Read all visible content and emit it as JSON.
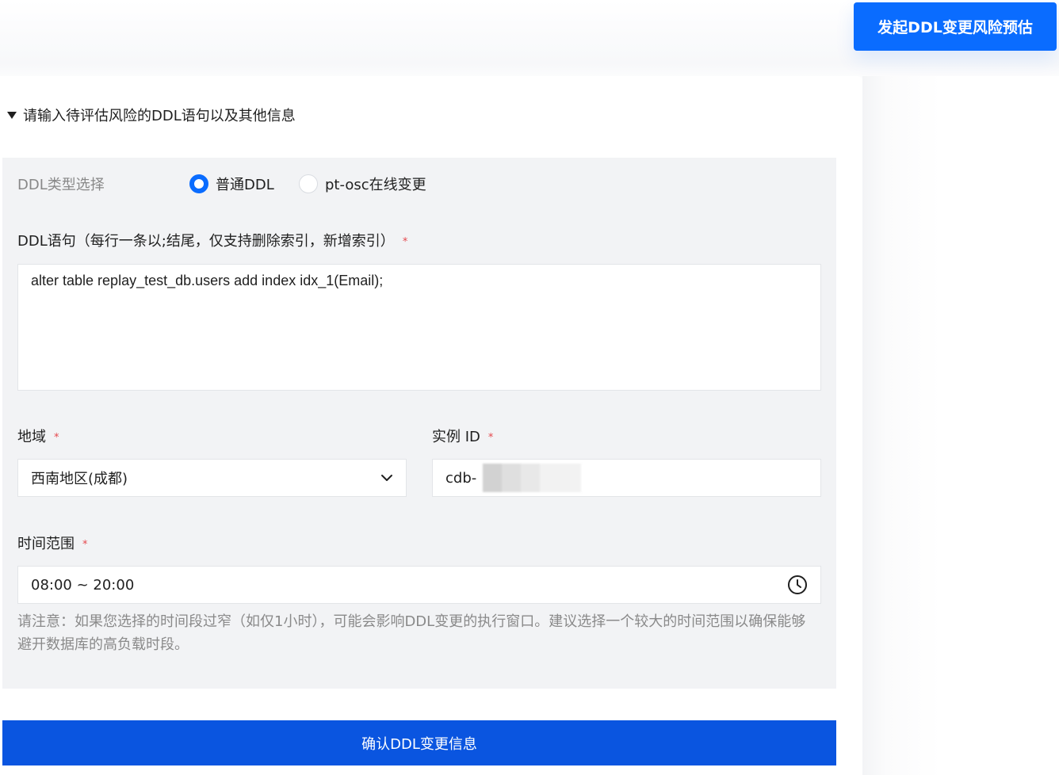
{
  "header": {
    "start_button_label": "发起DDL变更风险预估"
  },
  "section": {
    "title": "请输入待评估风险的DDL语句以及其他信息"
  },
  "ddl_type": {
    "label": "DDL类型选择",
    "options": [
      {
        "label": "普通DDL",
        "selected": true
      },
      {
        "label": "pt-osc在线变更",
        "selected": false
      }
    ]
  },
  "ddl_statement": {
    "label": "DDL语句（每行一条以;结尾，仅支持删除索引，新增索引）",
    "required_mark": "*",
    "value": "alter table replay_test_db.users add index idx_1(Email);"
  },
  "region": {
    "label": "地域",
    "required_mark": "*",
    "value": "西南地区(成都)"
  },
  "instance_id": {
    "label": "实例 ID",
    "required_mark": "*",
    "value": "cdb-"
  },
  "time_range": {
    "label": "时间范围",
    "required_mark": "*",
    "value": "08:00 ~ 20:00",
    "note": "请注意：如果您选择的时间段过窄（如仅1小时），可能会影响DDL变更的执行窗口。建议选择一个较大的时间范围以确保能够避开数据库的高负载时段。"
  },
  "confirm_button_label": "确认DDL变更信息",
  "colors": {
    "primary": "#0a6cff",
    "confirm": "#0a55e0",
    "panel_bg": "#f2f3f5",
    "required": "#e5484d"
  },
  "icons": [
    "collapse-triangle-icon",
    "chevron-down-icon",
    "clock-icon"
  ]
}
